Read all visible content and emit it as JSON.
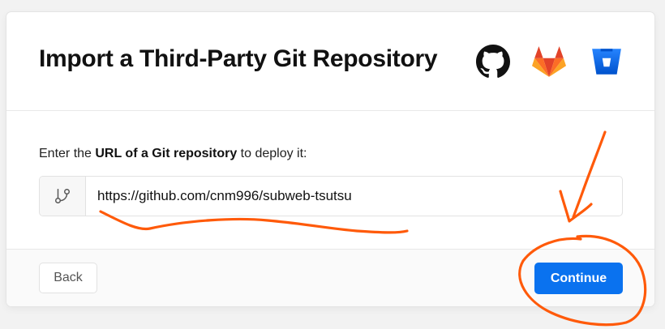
{
  "dialog": {
    "title": "Import a Third-Party Git Repository",
    "prompt_before": "Enter the ",
    "prompt_bold": "URL of a Git repository",
    "prompt_after": " to deploy it:",
    "url_value": "https://github.com/cnm996/subweb-tsutsu",
    "providers": [
      {
        "name": "GitHub",
        "icon": "github-icon"
      },
      {
        "name": "GitLab",
        "icon": "gitlab-icon"
      },
      {
        "name": "Bitbucket",
        "icon": "bitbucket-icon"
      }
    ]
  },
  "footer": {
    "back_label": "Back",
    "continue_label": "Continue"
  },
  "colors": {
    "accent": "#0a72ef",
    "annotation": "#ff5a0a",
    "gitlab_orange": "#fc6d26",
    "bitbucket_blue": "#2684ff"
  }
}
